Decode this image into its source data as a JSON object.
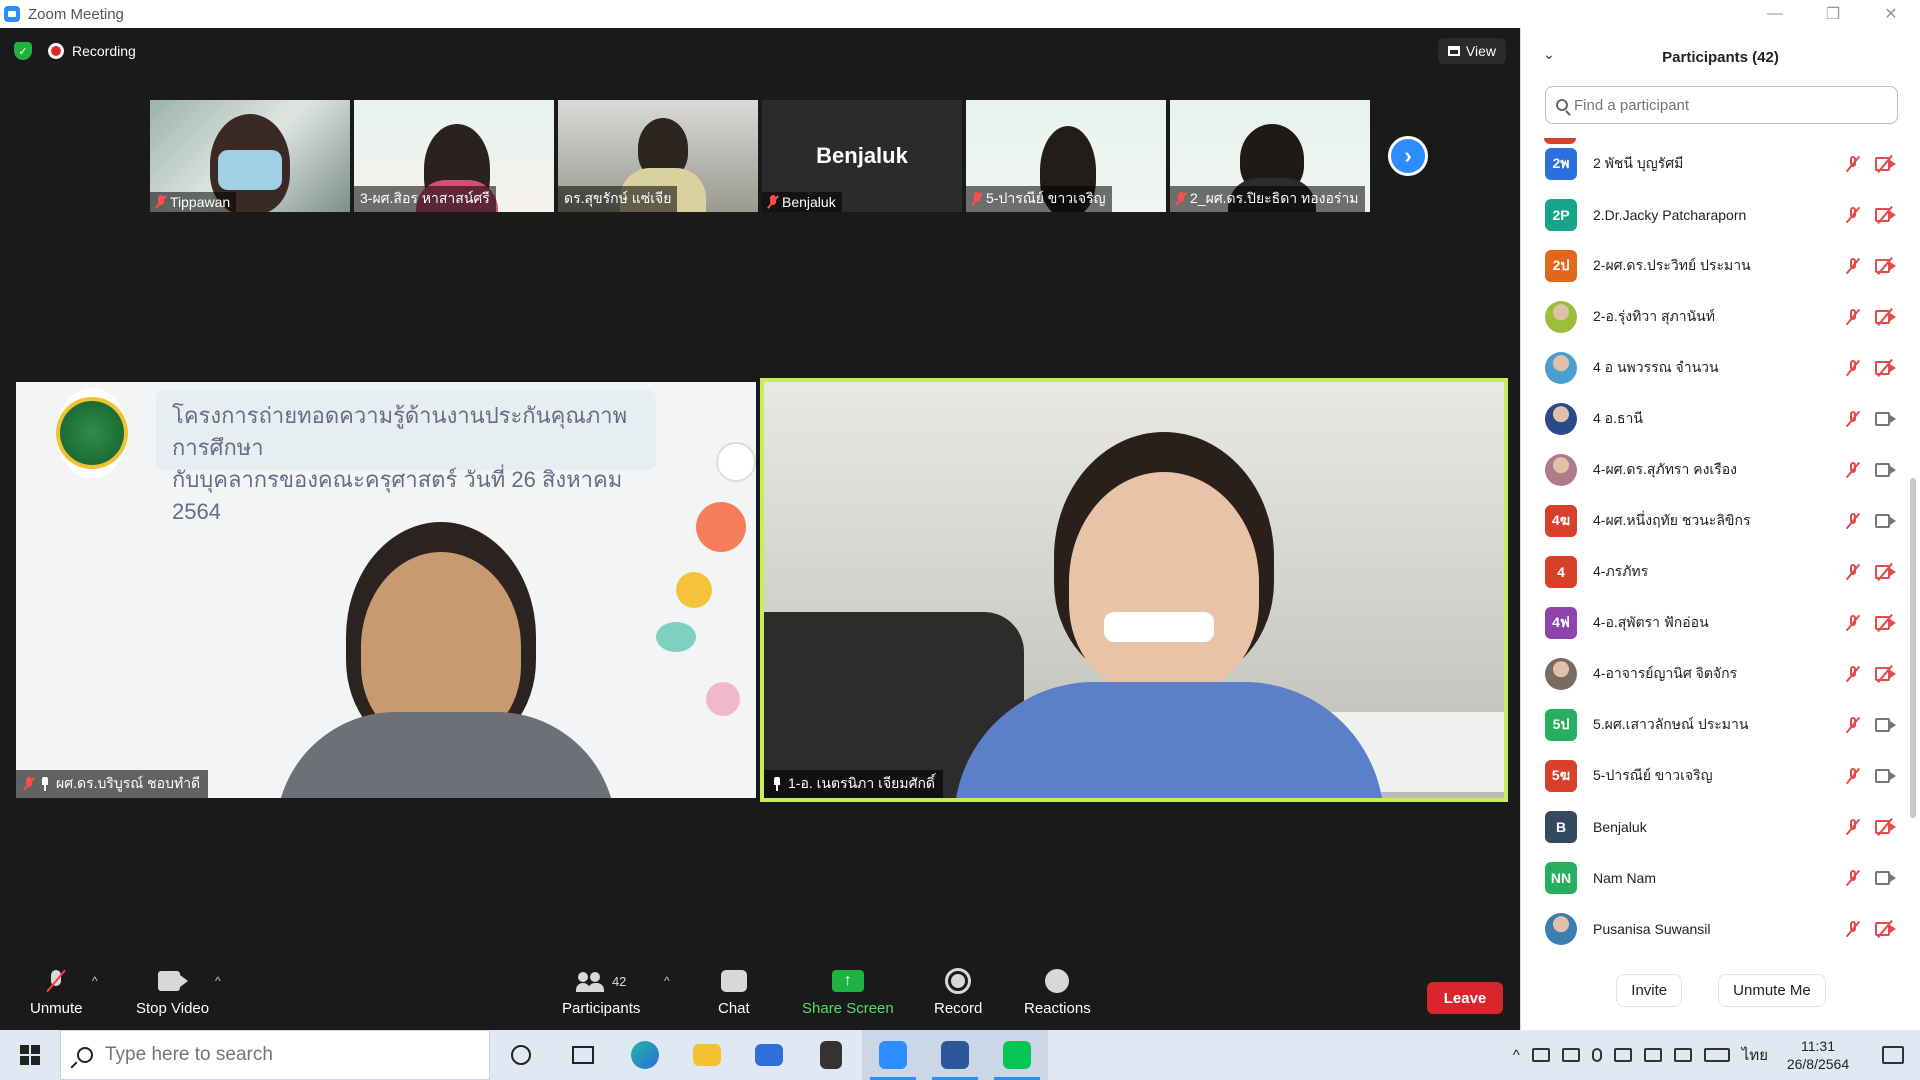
{
  "window": {
    "title": "Zoom Meeting"
  },
  "meeting": {
    "recording_label": "Recording",
    "view_label": "View",
    "thumbnails": [
      {
        "name": "Tippawan",
        "muted": true
      },
      {
        "name": "3-ผศ.สิอร หาสาสน์ศรี",
        "muted": false
      },
      {
        "name": "ดร.สุขรักษ์ แซ่เจีย",
        "muted": false
      },
      {
        "name": "Benjaluk",
        "muted": true,
        "name_only": "Benjaluk"
      },
      {
        "name": "5-ปารณีย์ ขาวเจริญ",
        "muted": true
      },
      {
        "name": "2_ผศ.ดร.ปิยะธิดา ทองอร่าม",
        "muted": true
      }
    ],
    "main_videos": [
      {
        "name": "ผศ.ดร.บริบูรณ์ ชอบทำดี",
        "muted": true,
        "pinned": true,
        "banner_line1": "โครงการถ่ายทอดความรู้ด้านงานประกันคุณภาพการศึกษา",
        "banner_line2": "กับบุคลากรของคณะครุศาสตร์ วันที่ 26 สิงหาคม 2564"
      },
      {
        "name": "1-อ. เนตรนิภา เจียมศักดิ์",
        "muted": false,
        "pinned": true,
        "active_speaker": true
      }
    ]
  },
  "toolbar": {
    "unmute": "Unmute",
    "stop_video": "Stop Video",
    "participants": "Participants",
    "participants_count": "42",
    "chat": "Chat",
    "share_screen": "Share Screen",
    "record": "Record",
    "reactions": "Reactions",
    "leave": "Leave"
  },
  "panel": {
    "title": "Participants (42)",
    "search_placeholder": "Find a participant",
    "participants": [
      {
        "initials": "2พ",
        "name": "2  พัชนี บุญรัศมี",
        "color": "#2a6fdb",
        "video": "off"
      },
      {
        "initials": "2P",
        "name": "2.Dr.Jacky Patcharaporn",
        "color": "#17a589",
        "video": "off"
      },
      {
        "initials": "2ป",
        "name": "2-ผศ.ดร.ประวิทย์ ประมาน",
        "color": "#e0671b",
        "video": "off"
      },
      {
        "initials": "",
        "name": "2-อ.รุ่งทิวา สุภานันท์",
        "color": "#9bbf3a",
        "video": "off",
        "photo": true
      },
      {
        "initials": "",
        "name": "4 อ นพวรรณ จำนวน",
        "color": "#4a9fd0",
        "video": "off",
        "photo": true
      },
      {
        "initials": "",
        "name": "4 อ.ธานี",
        "color": "#2b4a8a",
        "video": "on",
        "photo": true
      },
      {
        "initials": "",
        "name": "4-ผศ.ดร.สุภัทรา คงเรือง",
        "color": "#b07a8a",
        "video": "on",
        "photo": true
      },
      {
        "initials": "4ฆ",
        "name": "4-ผศ.หนึ่งฤทัย  ชวนะลิขิกร",
        "color": "#d9402b",
        "video": "on"
      },
      {
        "initials": "4",
        "name": "4-ภรภัทร",
        "color": "#d9402b",
        "video": "off"
      },
      {
        "initials": "4ฟ",
        "name": "4-อ.สุพัตรา  ฟักอ่อน",
        "color": "#8e44ad",
        "video": "off"
      },
      {
        "initials": "",
        "name": "4-อาจารย์ญานิศ จิตจักร",
        "color": "#7a6a60",
        "video": "off",
        "photo": true
      },
      {
        "initials": "5ป",
        "name": "5.ผศ.เสาวลักษณ์ ประมาน",
        "color": "#27ae60",
        "video": "on"
      },
      {
        "initials": "5ฆ",
        "name": "5-ปารณีย์ ขาวเจริญ",
        "color": "#d9402b",
        "video": "on"
      },
      {
        "initials": "B",
        "name": "Benjaluk",
        "color": "#34495e",
        "video": "off"
      },
      {
        "initials": "NN",
        "name": "Nam Nam",
        "color": "#27ae60",
        "video": "on"
      },
      {
        "initials": "",
        "name": "Pusanisa Suwansil",
        "color": "#3a7fb0",
        "video": "off",
        "photo": true
      }
    ],
    "invite": "Invite",
    "unmute_me": "Unmute Me"
  },
  "taskbar": {
    "search_placeholder": "Type here to search",
    "lang": "ไทย",
    "time": "11:31",
    "date": "26/8/2564"
  }
}
